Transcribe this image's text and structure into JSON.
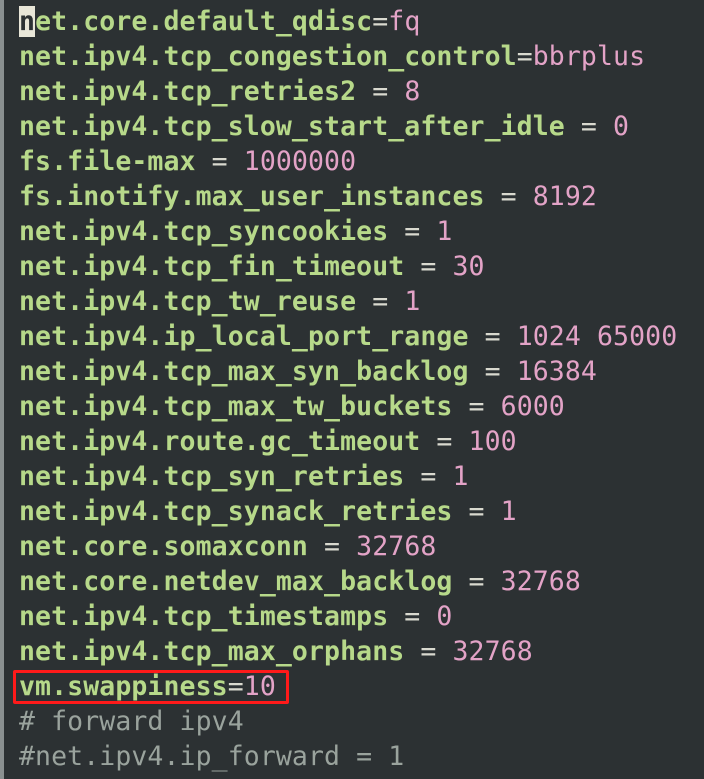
{
  "editor": {
    "lines": [
      {
        "cursor_char": "n",
        "key": "et.core.default_qdisc",
        "sep": "=",
        "value": "fq"
      },
      {
        "key": "net.ipv4.tcp_congestion_control",
        "sep": "=",
        "value": "bbrplus"
      },
      {
        "key": "net.ipv4.tcp_retries2",
        "sep": " = ",
        "value": "8"
      },
      {
        "key": "net.ipv4.tcp_slow_start_after_idle",
        "sep": " = ",
        "value": "0"
      },
      {
        "key": "fs.file-max",
        "sep": " = ",
        "value": "1000000"
      },
      {
        "key": "fs.inotify.max_user_instances",
        "sep": " = ",
        "value": "8192"
      },
      {
        "key": "net.ipv4.tcp_syncookies",
        "sep": " = ",
        "value": "1"
      },
      {
        "key": "net.ipv4.tcp_fin_timeout",
        "sep": " = ",
        "value": "30"
      },
      {
        "key": "net.ipv4.tcp_tw_reuse",
        "sep": " = ",
        "value": "1"
      },
      {
        "key": "net.ipv4.ip_local_port_range",
        "sep": " = ",
        "value": "1024 65000"
      },
      {
        "key": "net.ipv4.tcp_max_syn_backlog",
        "sep": " = ",
        "value": "16384"
      },
      {
        "key": "net.ipv4.tcp_max_tw_buckets",
        "sep": " = ",
        "value": "6000"
      },
      {
        "key": "net.ipv4.route.gc_timeout",
        "sep": " = ",
        "value": "100"
      },
      {
        "key": "net.ipv4.tcp_syn_retries",
        "sep": " = ",
        "value": "1"
      },
      {
        "key": "net.ipv4.tcp_synack_retries",
        "sep": " = ",
        "value": "1"
      },
      {
        "key": "net.core.somaxconn",
        "sep": " = ",
        "value": "32768"
      },
      {
        "key": "net.core.netdev_max_backlog",
        "sep": " = ",
        "value": "32768"
      },
      {
        "key": "net.ipv4.tcp_timestamps",
        "sep": " = ",
        "value": "0"
      },
      {
        "key": "net.ipv4.tcp_max_orphans",
        "sep": " = ",
        "value": "32768"
      },
      {
        "key": "vm.swappiness",
        "sep": "=",
        "value": "10"
      }
    ],
    "comments": [
      "# forward ipv4",
      "#net.ipv4.ip_forward = 1"
    ]
  },
  "colors": {
    "background": "#2c3133",
    "key": "#b7d98a",
    "value": "#e3a3c7",
    "comment": "#9aa39d",
    "highlight_box": "#ff1a1a"
  }
}
